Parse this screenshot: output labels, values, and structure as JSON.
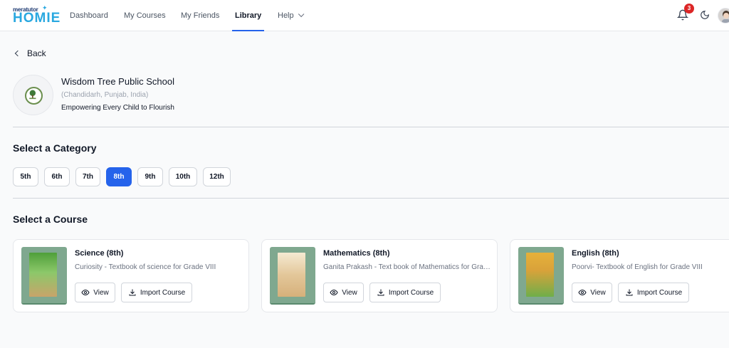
{
  "brand": {
    "small": "meratutor",
    "big": "HOMIE"
  },
  "nav": [
    {
      "label": "Dashboard"
    },
    {
      "label": "My Courses"
    },
    {
      "label": "My Friends"
    },
    {
      "label": "Library"
    },
    {
      "label": "Help"
    }
  ],
  "notifications": {
    "count": "3"
  },
  "back_label": "Back",
  "school": {
    "name": "Wisdom Tree Public School",
    "location": "(Chandidarh, Punjab, India)",
    "tagline": "Empowering Every Child to Flourish"
  },
  "category": {
    "title": "Select a Category",
    "items": [
      "5th",
      "6th",
      "7th",
      "8th",
      "9th",
      "10th",
      "12th"
    ],
    "selected": "8th"
  },
  "courses": {
    "title": "Select a Course",
    "view_label": "View",
    "import_label": "Import Course",
    "items": [
      {
        "title": "Science (8th)",
        "desc": "Curiosity - Textbook of science for Grade VIII",
        "cover_color": "#5aa63c"
      },
      {
        "title": "Mathematics (8th)",
        "desc": "Ganita Prakash - Text book of Mathematics for Grade VIII",
        "cover_color": "#e3c79a"
      },
      {
        "title": "English (8th)",
        "desc": "Poorvi- Textbook of English for Grade VIII",
        "cover_color": "#d9a23a"
      }
    ]
  },
  "colors": {
    "accent": "#2563eb",
    "badge": "#dc2626",
    "brand": "#29a8e0"
  },
  "icons": [
    "bell-icon",
    "moon-icon",
    "back-chevron-icon",
    "eye-icon",
    "download-icon",
    "chevron-down-icon"
  ]
}
